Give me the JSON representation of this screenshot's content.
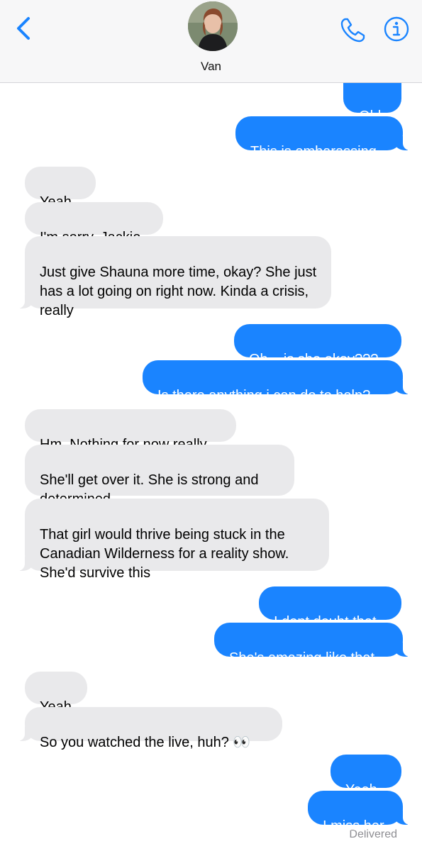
{
  "header": {
    "contact_name": "Van",
    "back_icon": "chevron-left-icon",
    "phone_icon": "phone-icon",
    "info_icon": "info-icon",
    "accent_color": "#1a84ff"
  },
  "messages": [
    {
      "direction": "outgoing",
      "text": "Ohh"
    },
    {
      "direction": "outgoing",
      "text": "This is embarassing"
    },
    {
      "direction": "incoming",
      "text": "Yeah."
    },
    {
      "direction": "incoming",
      "text": "I'm sorry, Jackie"
    },
    {
      "direction": "incoming",
      "text": "Just give Shauna more time, okay? She just has a lot going on right now. Kinda a crisis, really"
    },
    {
      "direction": "outgoing",
      "text": "Oh... is she okay???"
    },
    {
      "direction": "outgoing",
      "text": "Is there anything i can do to help?"
    },
    {
      "direction": "incoming",
      "text": "Hm. Nothing for now really"
    },
    {
      "direction": "incoming",
      "text": "She'll get over it. She is strong and determined"
    },
    {
      "direction": "incoming",
      "text": "That girl would thrive being stuck in the Canadian Wilderness for a reality show. She'd survive this"
    },
    {
      "direction": "outgoing",
      "text": "I dont doubt that"
    },
    {
      "direction": "outgoing",
      "text": "She's amazing like that"
    },
    {
      "direction": "incoming",
      "text": "Yeah"
    },
    {
      "direction": "incoming",
      "text": "So you watched the live, huh? 👀"
    },
    {
      "direction": "outgoing",
      "text": "Yeah."
    },
    {
      "direction": "outgoing",
      "text": "I miss her"
    }
  ],
  "status": {
    "delivered": "Delivered"
  },
  "colors": {
    "outgoing_bubble": "#1a84ff",
    "incoming_bubble": "#e9e9eb"
  }
}
